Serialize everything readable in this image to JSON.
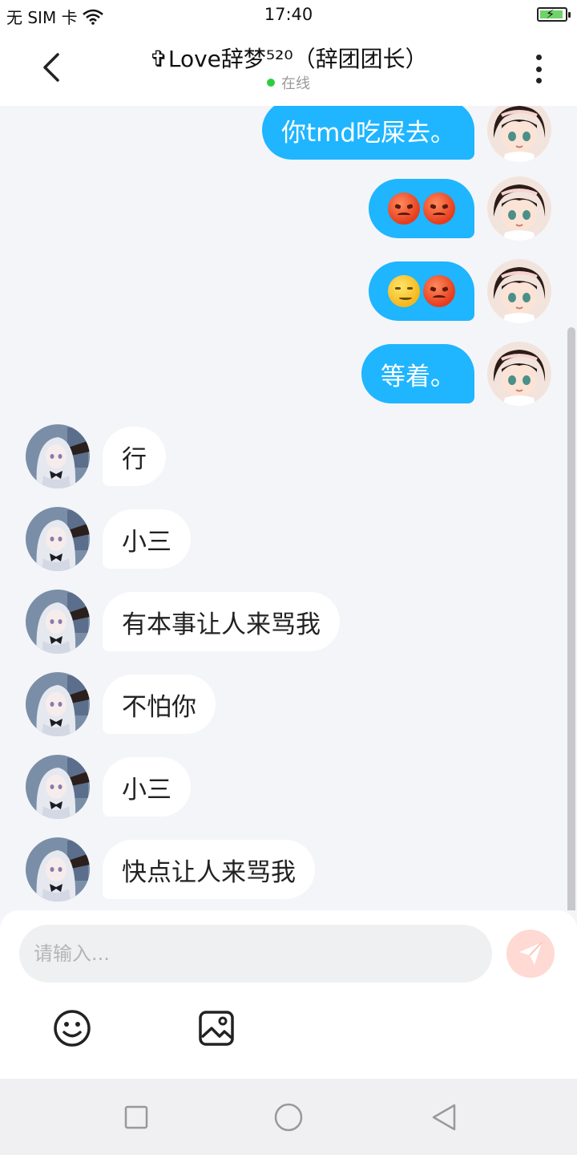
{
  "status_bar": {
    "carrier": "无 SIM 卡",
    "time": "17:40",
    "wifi_icon": "wifi-icon",
    "battery_icon": "battery-charging-icon"
  },
  "header": {
    "title": "✞Love辞梦⁵²⁰（辞团团长）",
    "status": "在线",
    "status_color": "#2ecc40"
  },
  "messages": [
    {
      "from": "me",
      "text": "你tmd吃屎去。"
    },
    {
      "from": "me",
      "emojis": [
        "angry-face-emoji",
        "angry-face-emoji"
      ]
    },
    {
      "from": "me",
      "emojis": [
        "smirking-face-emoji",
        "angry-face-emoji"
      ]
    },
    {
      "from": "me",
      "text": "等着。"
    },
    {
      "from": "other",
      "text": "行"
    },
    {
      "from": "other",
      "text": "小三"
    },
    {
      "from": "other",
      "text": "有本事让人来骂我"
    },
    {
      "from": "other",
      "text": "不怕你"
    },
    {
      "from": "other",
      "text": "小三"
    },
    {
      "from": "other",
      "text": "快点让人来骂我"
    }
  ],
  "input": {
    "placeholder": "请输入...",
    "value": ""
  },
  "toolbar": {
    "emoji_icon": "smiley-icon",
    "image_icon": "image-icon",
    "send_icon": "paper-plane-icon"
  },
  "colors": {
    "my_bubble": "#1fb5ff",
    "other_bubble": "#ffffff",
    "background": "#f4f5f8",
    "send_button": "#ffd9d3"
  }
}
